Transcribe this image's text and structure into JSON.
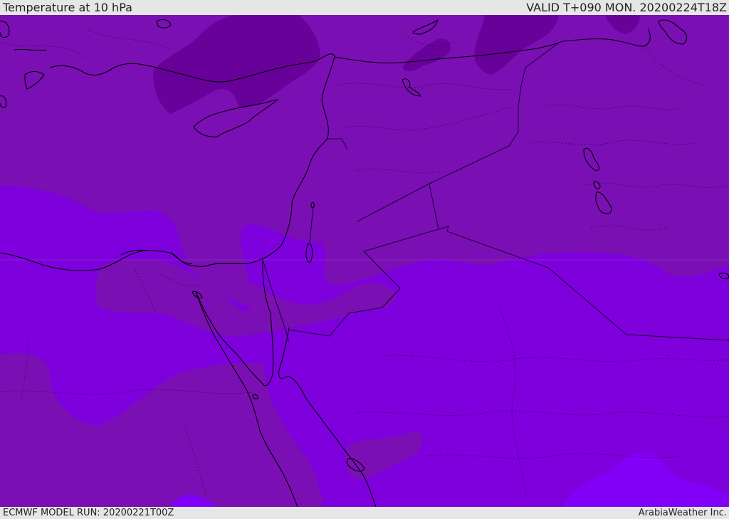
{
  "header": {
    "title": "Temperature at 10 hPa",
    "valid": "VALID T+090 MON. 20200224T18Z"
  },
  "footer": {
    "model_run": "ECMWF MODEL RUN: 20200221T00Z",
    "credit": "ArabiaWeather Inc."
  },
  "colors": {
    "band_cold_dark": "#68009a",
    "band_cold": "#7a10b4",
    "band_mid": "#7e00dc",
    "band_warm": "#8200f8",
    "coastline": "#000000",
    "border": "#1a0030",
    "chrome": "#e6e6e6"
  }
}
